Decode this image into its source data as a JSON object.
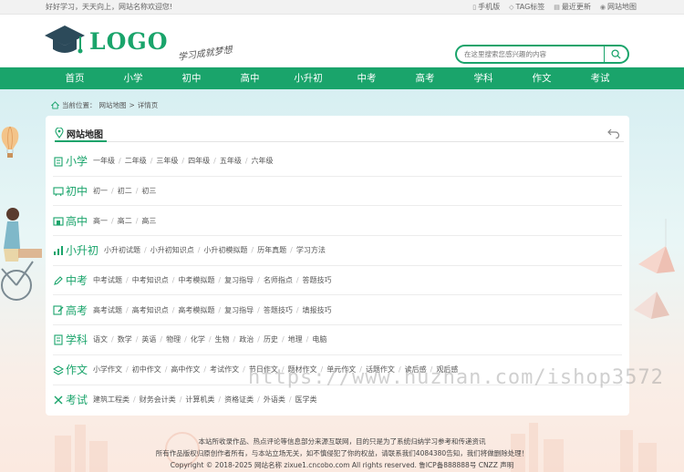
{
  "topbar": {
    "welcome": "好好学习，天天向上，网站名称欢迎您!",
    "links": [
      {
        "icon": "mobile-icon",
        "label": "手机版"
      },
      {
        "icon": "tag-icon",
        "label": "TAG标签"
      },
      {
        "icon": "document-icon",
        "label": "最近更新"
      },
      {
        "icon": "location-icon",
        "label": "网站地图"
      }
    ]
  },
  "header": {
    "logo_text": "LOGO",
    "slogan": "学习成就梦想",
    "search_placeholder": "在这里搜索您感兴趣的内容"
  },
  "nav": [
    "首页",
    "小学",
    "初中",
    "高中",
    "小升初",
    "中考",
    "高考",
    "学科",
    "作文",
    "考试"
  ],
  "breadcrumb": {
    "prefix": "当前位置：",
    "site_map": "网站地图",
    "separator": ">",
    "current": "详情页"
  },
  "card": {
    "title": "网站地图"
  },
  "rows": [
    {
      "icon": "building-icon",
      "label": "小学",
      "items": [
        "一年级",
        "二年级",
        "三年级",
        "四年级",
        "五年级",
        "六年级"
      ]
    },
    {
      "icon": "blackboard-icon",
      "label": "初中",
      "items": [
        "初一",
        "初二",
        "初三"
      ]
    },
    {
      "icon": "school-icon",
      "label": "高中",
      "items": [
        "高一",
        "高二",
        "高三"
      ]
    },
    {
      "icon": "bar-chart-icon",
      "label": "小升初",
      "items": [
        "小升初试题",
        "小升初知识点",
        "小升初模拟题",
        "历年真题",
        "学习方法"
      ]
    },
    {
      "icon": "edit-icon",
      "label": "中考",
      "items": [
        "中考试题",
        "中考知识点",
        "中考模拟题",
        "复习指导",
        "名师指点",
        "答题技巧"
      ]
    },
    {
      "icon": "pencil-icon",
      "label": "高考",
      "items": [
        "高考试题",
        "高考知识点",
        "高考模拟题",
        "复习指导",
        "答题技巧",
        "填报技巧"
      ]
    },
    {
      "icon": "notebook-icon",
      "label": "学科",
      "items": [
        "语文",
        "数学",
        "英语",
        "物理",
        "化学",
        "生物",
        "政治",
        "历史",
        "地理",
        "电脑"
      ]
    },
    {
      "icon": "layers-icon",
      "label": "作文",
      "items": [
        "小学作文",
        "初中作文",
        "高中作文",
        "考试作文",
        "节日作文",
        "题材作文",
        "单元作文",
        "话题作文",
        "读后感",
        "观后感"
      ]
    },
    {
      "icon": "tools-icon",
      "label": "考试",
      "items": [
        "建筑工程类",
        "财务会计类",
        "计算机类",
        "资格证类",
        "外语类",
        "医学类"
      ]
    }
  ],
  "footer": {
    "line1": "本站所收录作品、热点评论等信息部分来源互联网，目的只是为了系统归纳学习参考和传递资讯",
    "line2": "所有作品版权归原创作者所有，与本站立场无关，如不慎侵犯了你的权益，请联系我们4084380告知，我们将做删除处理！",
    "line3": "Copyright © 2018-2025 网站名称 zixue1.cncobo.com All rights reserved. 鲁ICP备888888号 CNZZ 声明"
  },
  "watermark": "https://www.huzhan.com/ishop3572",
  "colors": {
    "brand": "#1aa46b",
    "logo_dark": "#2c4a5a"
  }
}
